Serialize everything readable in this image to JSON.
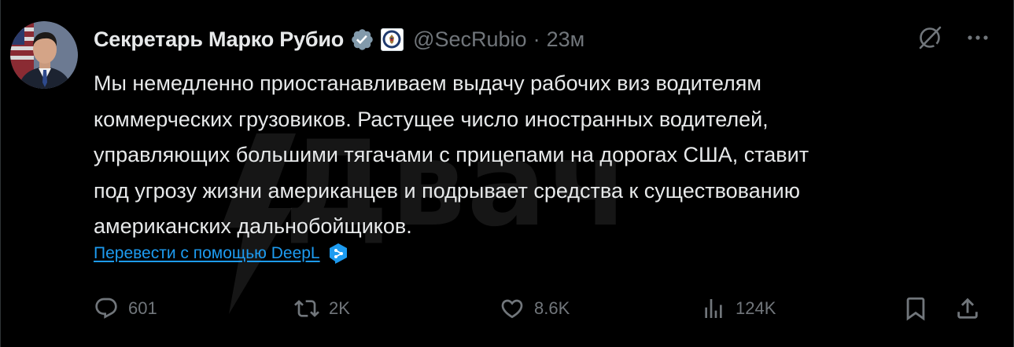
{
  "author": {
    "display_name": "Секретарь Марко Рубио",
    "handle": "@SecRubio",
    "separator": "·",
    "time": "23м"
  },
  "tweet": {
    "lines": [
      "Мы немедленно приостанавливаем выдачу рабочих виз водителям",
      "коммерческих грузовиков. Растущее число иностранных водителей,",
      "управляющих большими тягачами с прицепами на дорогах США, ставит",
      "под угрозу жизни американцев и подрывает средства к существованию",
      "американских дальнобойщиков."
    ]
  },
  "translate": {
    "label": "Перевести с помощью DeepL"
  },
  "stats": {
    "replies": "601",
    "reposts": "2K",
    "likes": "8.6K",
    "views": "124K"
  },
  "watermark": {
    "text": "Двач"
  },
  "icons": {
    "verified": "verified-checkmark-icon",
    "gov_badge": "state-department-seal-icon",
    "grok": "grok-icon",
    "more": "more-horizontal-icon",
    "reply": "reply-icon",
    "repost": "repost-icon",
    "like": "heart-icon",
    "views": "analytics-icon",
    "bookmark": "bookmark-icon",
    "share": "share-icon",
    "deepl": "deepl-icon"
  },
  "colors": {
    "background": "#000000",
    "text": "#e7e9ea",
    "muted": "#71767b",
    "link": "#1d9bf0",
    "verified_badge": "#829aab"
  }
}
